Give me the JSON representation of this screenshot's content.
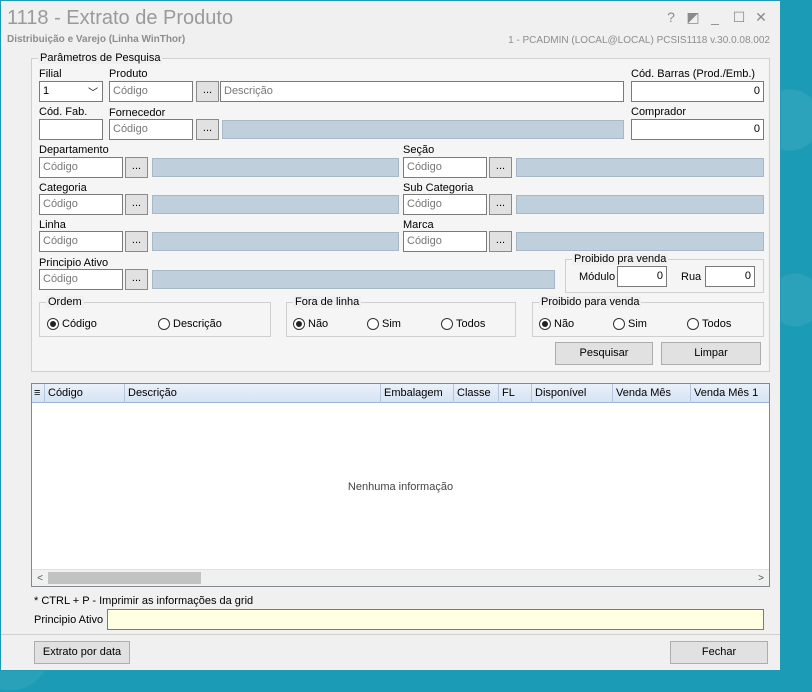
{
  "window": {
    "title": "1118 - Extrato de Produto",
    "subtitle": "Distribuição e Varejo (Linha WinThor)",
    "user_info": "1 - PCADMIN (LOCAL@LOCAL)   PCSIS1118  v.30.0.08.002",
    "help_glyph": "?",
    "restore_glyph": "◩",
    "minimize_glyph": "_",
    "maximize_glyph": "☐",
    "close_glyph": "✕"
  },
  "params": {
    "legend": "Parâmetros de Pesquisa",
    "filial_label": "Filial",
    "filial_value": "1",
    "produto_label": "Produto",
    "produto_codigo": "Código",
    "produto_descricao": "Descrição",
    "cod_barras_label": "Cód. Barras (Prod./Emb.)",
    "cod_barras_value": "0",
    "cod_fab_label": "Cód. Fab.",
    "fornecedor_label": "Fornecedor",
    "fornecedor_codigo": "Código",
    "comprador_label": "Comprador",
    "comprador_value": "0",
    "departamento_label": "Departamento",
    "departamento_codigo": "Código",
    "secao_label": "Seção",
    "secao_codigo": "Código",
    "categoria_label": "Categoria",
    "categoria_codigo": "Código",
    "subcategoria_label": "Sub Categoria",
    "subcategoria_codigo": "Código",
    "linha_label": "Linha",
    "linha_codigo": "Código",
    "marca_label": "Marca",
    "marca_codigo": "Código",
    "principio_label": "Principio Ativo",
    "principio_codigo": "Código",
    "dots": "...",
    "proibido_box": {
      "legend": "Proibido pra venda",
      "modulo_label": "Módulo",
      "modulo_value": "0",
      "rua_label": "Rua",
      "rua_value": "0"
    },
    "ordem": {
      "legend": "Ordem",
      "opt1": "Código",
      "opt2": "Descrição"
    },
    "fora_linha": {
      "legend": "Fora de linha",
      "opt1": "Não",
      "opt2": "Sim",
      "opt3": "Todos"
    },
    "proibido_venda": {
      "legend": "Proibido para venda",
      "opt1": "Não",
      "opt2": "Sim",
      "opt3": "Todos"
    },
    "pesquisar": "Pesquisar",
    "limpar": "Limpar"
  },
  "grid": {
    "columns": [
      "Código",
      "Descrição",
      "Embalagem",
      "Classe",
      "FL",
      "Disponível",
      "Venda Mês",
      "Venda Mês 1"
    ],
    "empty_text": "Nenhuma informação",
    "scroll_left": "<",
    "scroll_right": ">"
  },
  "footer": {
    "hint": "* CTRL + P - Imprimir as informações da grid",
    "principio_label": "Principio Ativo",
    "extrato_button": "Extrato por data",
    "fechar_button": "Fechar"
  }
}
